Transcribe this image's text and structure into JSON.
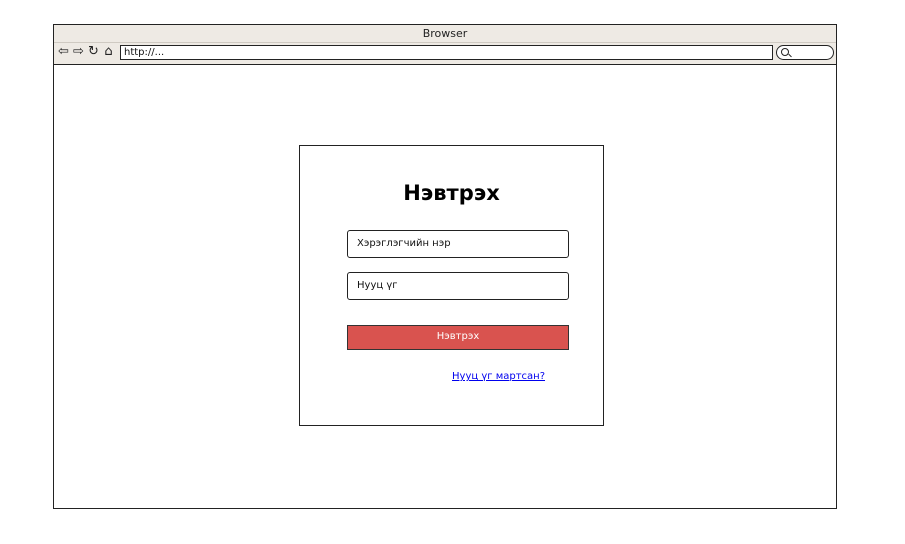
{
  "browser": {
    "title": "Browser",
    "address": "http://..."
  },
  "login": {
    "title": "Нэвтрэх",
    "username_placeholder": "Хэрэглэгчийн нэр",
    "password_placeholder": "Нууц үг",
    "submit_label": "Нэвтрэх",
    "forgot_link": "Нууц үг мартсан?",
    "button_color": "#d9534f",
    "link_color": "#0000ee"
  },
  "icons": [
    "back-icon",
    "forward-icon",
    "reload-icon",
    "home-icon",
    "search-icon"
  ]
}
